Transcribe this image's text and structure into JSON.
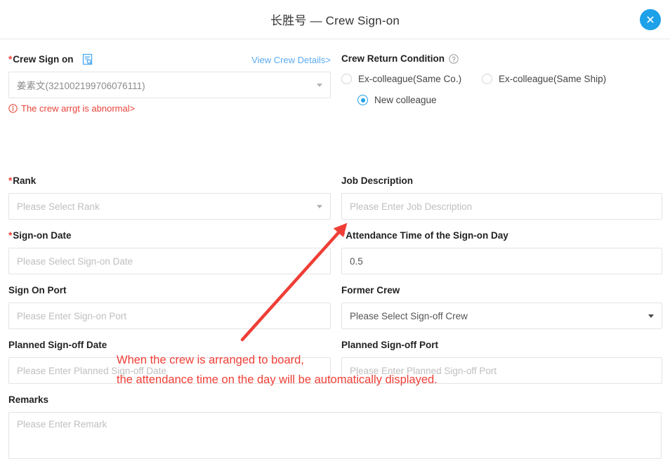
{
  "header": {
    "title": "长胜号 — Crew Sign-on",
    "close_label": "×"
  },
  "form": {
    "crew_sign_on": {
      "label": "Crew Sign on",
      "required": true,
      "icon": "document-search-icon",
      "view_details_link": "View Crew Details>",
      "value": "姜素文(321002199706076111)",
      "error": "The crew arrgt is abnormal>",
      "error_icon": "info-circle-icon"
    },
    "crew_return_condition": {
      "label": "Crew Return Condition",
      "help_icon": "question-circle-icon",
      "options": [
        {
          "label": "Ex-colleague(Same Co.)",
          "checked": false
        },
        {
          "label": "Ex-colleague(Same Ship)",
          "checked": false
        },
        {
          "label": "New colleague",
          "checked": true
        }
      ]
    },
    "rank": {
      "label": "Rank",
      "required": true,
      "placeholder": "Please Select Rank",
      "value": ""
    },
    "job_description": {
      "label": "Job Description",
      "required": false,
      "placeholder": "Please Enter Job Description",
      "value": ""
    },
    "sign_on_date": {
      "label": "Sign-on Date",
      "required": true,
      "placeholder": "Please Select Sign-on Date",
      "value": ""
    },
    "attendance_time": {
      "label": "Attendance Time of the Sign-on Day",
      "required": true,
      "value": "0.5"
    },
    "sign_on_port": {
      "label": "Sign On Port",
      "required": false,
      "placeholder": "Please Enter Sign-on Port",
      "value": ""
    },
    "former_crew": {
      "label": "Former Crew",
      "required": false,
      "placeholder": "Please Select Sign-off Crew",
      "value": ""
    },
    "planned_signoff_date": {
      "label": "Planned Sign-off Date",
      "required": false,
      "placeholder": "Please Enter Planned Sign-off Date",
      "value": ""
    },
    "planned_signoff_port": {
      "label": "Planned Sign-off Port",
      "required": false,
      "placeholder": "Please Enter Planned Sign-off Port",
      "value": ""
    },
    "remarks": {
      "label": "Remarks",
      "placeholder": "Please Enter Remark",
      "value": ""
    }
  },
  "annotations": {
    "line1": "When the crew is arranged to board,",
    "line2": "the attendance time on the day will be automatically displayed.",
    "arrow_color": "#ef3e36"
  },
  "colors": {
    "accent": "#1da1e8",
    "link": "#5aaaf0",
    "required": "#f04134",
    "error": "#e8443a",
    "annotation": "#ef3e36",
    "border": "#e4e4e4"
  }
}
